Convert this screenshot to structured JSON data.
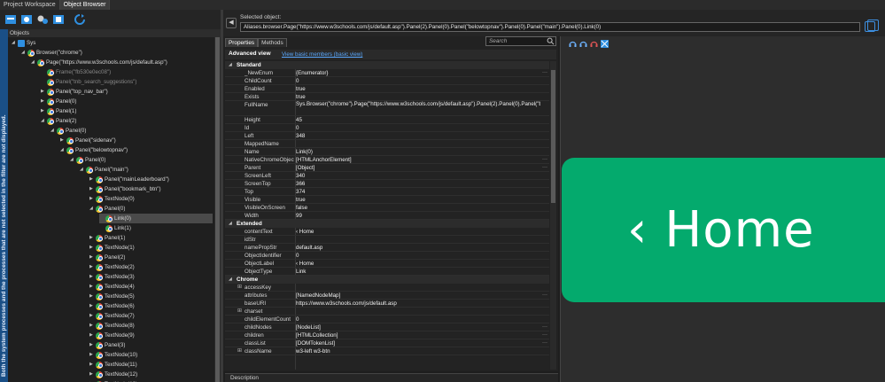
{
  "tabs": [
    "Project Workspace",
    "Object Browser"
  ],
  "sidebar_hint": "Both the system processes and the processes that are not selected in the filter are not displayed.",
  "objects": {
    "title": "Objects",
    "tree": [
      {
        "label": "Sys",
        "depth": 0,
        "icon": "windows-icon",
        "exp": "down"
      },
      {
        "label": "Browser(\"chrome\")",
        "depth": 1,
        "icon": "chrome-icon",
        "exp": "down"
      },
      {
        "label": "Page(\"https://www.w3schools.com/js/default.asp\")",
        "depth": 2,
        "icon": "chrome-icon",
        "exp": "down"
      },
      {
        "label": "Frame(\"fb530e0ec08\")",
        "depth": 3,
        "icon": "chrome-icon",
        "exp": "",
        "dim": true
      },
      {
        "label": "Panel(\"tnb_search_suggestions\")",
        "depth": 3,
        "icon": "chrome-icon",
        "exp": "",
        "dim": true
      },
      {
        "label": "Panel(\"top_nav_bar\")",
        "depth": 3,
        "icon": "chrome-icon",
        "exp": "right"
      },
      {
        "label": "Panel(0)",
        "depth": 3,
        "icon": "chrome-icon",
        "exp": "right"
      },
      {
        "label": "Panel(1)",
        "depth": 3,
        "icon": "chrome-icon",
        "exp": "right"
      },
      {
        "label": "Panel(2)",
        "depth": 3,
        "icon": "chrome-icon",
        "exp": "down"
      },
      {
        "label": "Panel(0)",
        "depth": 4,
        "icon": "chrome-icon",
        "exp": "down"
      },
      {
        "label": "Panel(\"sidenav\")",
        "depth": 5,
        "icon": "chrome-icon",
        "exp": "right"
      },
      {
        "label": "Panel(\"belowtopnav\")",
        "depth": 5,
        "icon": "chrome-icon",
        "exp": "down"
      },
      {
        "label": "Panel(0)",
        "depth": 6,
        "icon": "chrome-icon",
        "exp": "down"
      },
      {
        "label": "Panel(\"main\")",
        "depth": 7,
        "icon": "chrome-icon",
        "exp": "down"
      },
      {
        "label": "Panel(\"mainLeaderboard\")",
        "depth": 8,
        "icon": "chrome-icon",
        "exp": "right"
      },
      {
        "label": "Panel(\"bookmark_btn\")",
        "depth": 8,
        "icon": "chrome-icon",
        "exp": "right"
      },
      {
        "label": "TextNode(0)",
        "depth": 8,
        "icon": "chrome-icon",
        "exp": "right"
      },
      {
        "label": "Panel(0)",
        "depth": 8,
        "icon": "chrome-icon",
        "exp": "down"
      },
      {
        "label": "Link(0)",
        "depth": 9,
        "icon": "chrome-icon",
        "exp": "",
        "sel": true
      },
      {
        "label": "Link(1)",
        "depth": 9,
        "icon": "chrome-icon",
        "exp": ""
      },
      {
        "label": "Panel(1)",
        "depth": 8,
        "icon": "chrome-icon",
        "exp": "right"
      },
      {
        "label": "TextNode(1)",
        "depth": 8,
        "icon": "chrome-icon",
        "exp": "right"
      },
      {
        "label": "Panel(2)",
        "depth": 8,
        "icon": "chrome-icon",
        "exp": "right"
      },
      {
        "label": "TextNode(2)",
        "depth": 8,
        "icon": "chrome-icon",
        "exp": "right"
      },
      {
        "label": "TextNode(3)",
        "depth": 8,
        "icon": "chrome-icon",
        "exp": "right"
      },
      {
        "label": "TextNode(4)",
        "depth": 8,
        "icon": "chrome-icon",
        "exp": "right"
      },
      {
        "label": "TextNode(5)",
        "depth": 8,
        "icon": "chrome-icon",
        "exp": "right"
      },
      {
        "label": "TextNode(6)",
        "depth": 8,
        "icon": "chrome-icon",
        "exp": "right"
      },
      {
        "label": "TextNode(7)",
        "depth": 8,
        "icon": "chrome-icon",
        "exp": "right"
      },
      {
        "label": "TextNode(8)",
        "depth": 8,
        "icon": "chrome-icon",
        "exp": "right"
      },
      {
        "label": "TextNode(9)",
        "depth": 8,
        "icon": "chrome-icon",
        "exp": "right"
      },
      {
        "label": "Panel(3)",
        "depth": 8,
        "icon": "chrome-icon",
        "exp": "right"
      },
      {
        "label": "TextNode(10)",
        "depth": 8,
        "icon": "chrome-icon",
        "exp": "right"
      },
      {
        "label": "TextNode(11)",
        "depth": 8,
        "icon": "chrome-icon",
        "exp": "right"
      },
      {
        "label": "TextNode(12)",
        "depth": 8,
        "icon": "chrome-icon",
        "exp": "right"
      },
      {
        "label": "TextNode(13)",
        "depth": 8,
        "icon": "chrome-icon",
        "exp": "right"
      }
    ]
  },
  "selected_object": {
    "label": "Selected object:",
    "value": "Aliases.browser.Page(\"https://www.w3schools.com/js/default.asp\").Panel(2).Panel(0).Panel(\"belowtopnav\").Panel(0).Panel(\"main\").Panel(0).Link(0)"
  },
  "properties": {
    "tabs": [
      "Properties",
      "Methods"
    ],
    "search_placeholder": "Search",
    "advanced_view": "Advanced view",
    "basic_view_link": "View basic members (basic view)",
    "sections": [
      {
        "title": "Standard",
        "rows": [
          {
            "name": "_NewEnum",
            "value": "{Enumerator}",
            "dots": true
          },
          {
            "name": "ChildCount",
            "value": "0"
          },
          {
            "name": "Enabled",
            "value": "true"
          },
          {
            "name": "Exists",
            "value": "true"
          },
          {
            "name": "FullName",
            "value": "Sys.Browser(\"chrome\").Page(\"https://www.w3schools.com/js/default.asp\").Panel(2).Panel(0).Panel(\"belowtopnav\").Panel(0).Panel(\"main\").Panel(0).Link(0)",
            "tall": true
          },
          {
            "name": "Height",
            "value": "45"
          },
          {
            "name": "Id",
            "value": "0"
          },
          {
            "name": "Left",
            "value": "348"
          },
          {
            "name": "MappedName",
            "value": ""
          },
          {
            "name": "Name",
            "value": "Link(0)"
          },
          {
            "name": "NativeChromeObject",
            "value": "[HTMLAnchorElement]",
            "dots": true
          },
          {
            "name": "Parent",
            "value": "[Object]",
            "dots": true
          },
          {
            "name": "ScreenLeft",
            "value": "340"
          },
          {
            "name": "ScreenTop",
            "value": "366"
          },
          {
            "name": "Top",
            "value": "374"
          },
          {
            "name": "Visible",
            "value": "true"
          },
          {
            "name": "VisibleOnScreen",
            "value": "false"
          },
          {
            "name": "Width",
            "value": "99"
          }
        ]
      },
      {
        "title": "Extended",
        "rows": [
          {
            "name": "contentText",
            "value": "‹ Home"
          },
          {
            "name": "idStr",
            "value": ""
          },
          {
            "name": "namePropStr",
            "value": "default.asp"
          },
          {
            "name": "ObjectIdentifier",
            "value": "0"
          },
          {
            "name": "ObjectLabel",
            "value": "‹ Home"
          },
          {
            "name": "ObjectType",
            "value": "Link"
          }
        ]
      },
      {
        "title": "Chrome",
        "rows": [
          {
            "name": "accessKey",
            "value": "",
            "plus": true
          },
          {
            "name": "attributes",
            "value": "[NamedNodeMap]",
            "dots": true
          },
          {
            "name": "baseURI",
            "value": "https://www.w3schools.com/js/default.asp"
          },
          {
            "name": "charset",
            "value": "",
            "plus": true
          },
          {
            "name": "childElementCount",
            "value": "0"
          },
          {
            "name": "childNodes",
            "value": "[NodeList]",
            "dots": true
          },
          {
            "name": "children",
            "value": "[HTMLCollection]",
            "dots": true
          },
          {
            "name": "classList",
            "value": "[DOMTokenList]",
            "dots": true
          },
          {
            "name": "className",
            "value": "w3-left w3-btn",
            "plus": true
          }
        ]
      }
    ]
  },
  "description_label": "Description",
  "preview": {
    "button_text": "‹ Home",
    "button_color": "#04aa6d"
  }
}
